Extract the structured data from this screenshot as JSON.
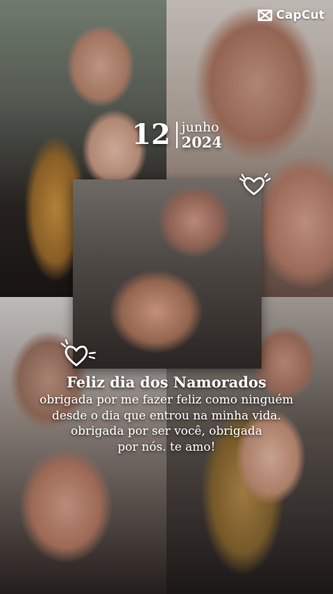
{
  "brand": {
    "name": "CapCut"
  },
  "date": {
    "day": "12",
    "month": "junho",
    "year": "2024"
  },
  "message": {
    "title": "Feliz dia dos Namorados",
    "lines": [
      "obrigada por me fazer feliz como ninguém",
      "desde o dia que entrou na minha vida.",
      "obrigada por ser você, obrigada",
      "por nós. te amo!"
    ]
  },
  "colors": {
    "text": "#ffffff"
  },
  "icons": [
    "capcut-logo-icon",
    "heart-doodle-icon"
  ]
}
